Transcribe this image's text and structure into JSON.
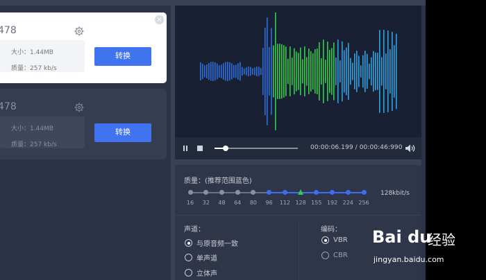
{
  "files": [
    {
      "name": "478",
      "size_label": "大小：1.44MB",
      "quality_label": "质量：257 kb/s",
      "convert": "转换",
      "active": true,
      "close": "×"
    },
    {
      "name": "478",
      "size_label": "大小：1.44MB",
      "quality_label": "质量：257 kb/s",
      "convert": "转换",
      "active": false
    }
  ],
  "player": {
    "time": "00:00:06.199 / 00:00:46:990",
    "progress": 0.132
  },
  "quality": {
    "label": "质量：(推荐范围蓝色)",
    "ticks": [
      "16",
      "32",
      "48",
      "64",
      "80",
      "96",
      "112",
      "128",
      "155",
      "192",
      "224",
      "256"
    ],
    "blue_from_index": 5,
    "selected_index": 7,
    "bitrate": "128kbit/s"
  },
  "channel": {
    "title": "声道：",
    "options": [
      {
        "label": "与原音频一致",
        "checked": true
      },
      {
        "label": "单声道",
        "checked": false
      },
      {
        "label": "立体声",
        "checked": false
      }
    ]
  },
  "encoding": {
    "title": "编码：",
    "options": [
      {
        "label": "VBR",
        "checked": true
      },
      {
        "label": "CBR",
        "checked": false
      }
    ]
  },
  "watermark": {
    "logo": "Bai du",
    "cn": "经验",
    "url": "jingyan.baidu.com"
  },
  "colors": {
    "accent": "#3f73f0",
    "wave_blue": "#2e6fe0",
    "wave_green": "#2fcf4a",
    "wave_cyan": "#2aa3e0"
  }
}
